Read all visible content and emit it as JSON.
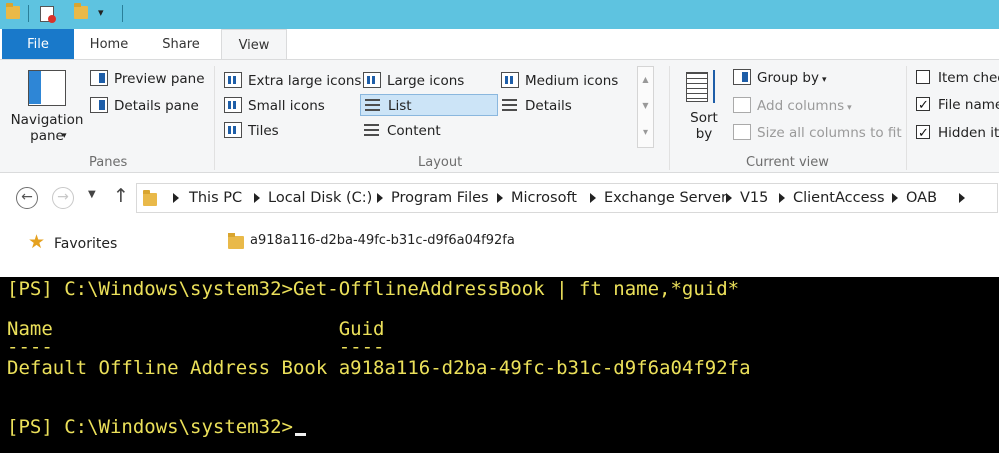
{
  "tabs": {
    "file": "File",
    "home": "Home",
    "share": "Share",
    "view": "View"
  },
  "ribbon": {
    "panes": {
      "navigation_pane": "Navigation\npane",
      "preview_pane": "Preview pane",
      "details_pane": "Details pane",
      "group_label": "Panes"
    },
    "layout": {
      "extra_large_icons": "Extra large icons",
      "large_icons": "Large icons",
      "medium_icons": "Medium icons",
      "small_icons": "Small icons",
      "list": "List",
      "details": "Details",
      "tiles": "Tiles",
      "content": "Content",
      "group_label": "Layout",
      "selected": "List"
    },
    "current_view": {
      "sort_by": "Sort\nby",
      "group_by": "Group by",
      "add_columns": "Add columns",
      "size_all_columns": "Size all columns to fit",
      "group_label": "Current view"
    },
    "show_hide": {
      "item_check_boxes": {
        "label": "Item chec",
        "checked": false
      },
      "file_name_extensions": {
        "label": "File name",
        "checked": true
      },
      "hidden_items": {
        "label": "Hidden it",
        "checked": true
      }
    }
  },
  "address_bar": {
    "breadcrumbs": [
      "This PC",
      "Local Disk (C:)",
      "Program Files",
      "Microsoft",
      "Exchange Server",
      "V15",
      "ClientAccess",
      "OAB"
    ]
  },
  "navigation": {
    "favorites": "Favorites"
  },
  "file_list": {
    "items": [
      "a918a116-d2ba-49fc-b31c-d9f6a04f92fa"
    ]
  },
  "console": {
    "line1": "[PS] C:\\Windows\\system32>Get-OfflineAddressBook | ft name,*guid*",
    "header": "Name                         Guid",
    "underline": "----                         ----",
    "row": "Default Offline Address Book a918a116-d2ba-49fc-b31c-d9f6a04f92fa",
    "prompt": "[PS] C:\\Windows\\system32>"
  },
  "colors": {
    "file_tab": "#1979ca",
    "title_bar": "#5ec3e0",
    "console_text": "#ebe05a",
    "console_bg": "#000000"
  }
}
